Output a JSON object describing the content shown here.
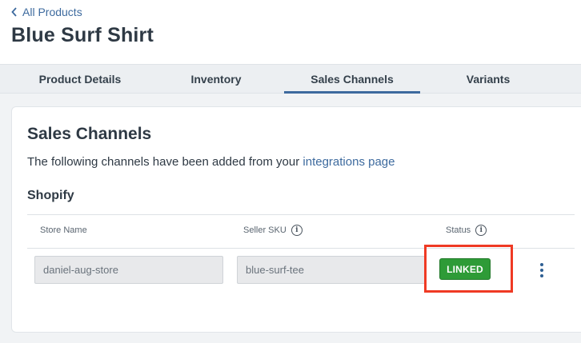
{
  "header": {
    "back_label": "All Products",
    "title": "Blue Surf Shirt"
  },
  "tabs": [
    {
      "label": "Product Details",
      "active": false
    },
    {
      "label": "Inventory",
      "active": false
    },
    {
      "label": "Sales Channels",
      "active": true
    },
    {
      "label": "Variants",
      "active": false
    }
  ],
  "sales_channels": {
    "title": "Sales Channels",
    "description_prefix": "The following channels have been added from your ",
    "description_link": "integrations page",
    "section": "Shopify",
    "columns": {
      "store_name": "Store Name",
      "seller_sku": "Seller SKU",
      "status": "Status"
    },
    "row": {
      "store_name": "daniel-aug-store",
      "seller_sku": "blue-surf-tee",
      "status": "LINKED"
    }
  },
  "colors": {
    "accent": "#3d6a9e",
    "status_linked": "#2e9b37",
    "highlight": "#ef3a24"
  }
}
